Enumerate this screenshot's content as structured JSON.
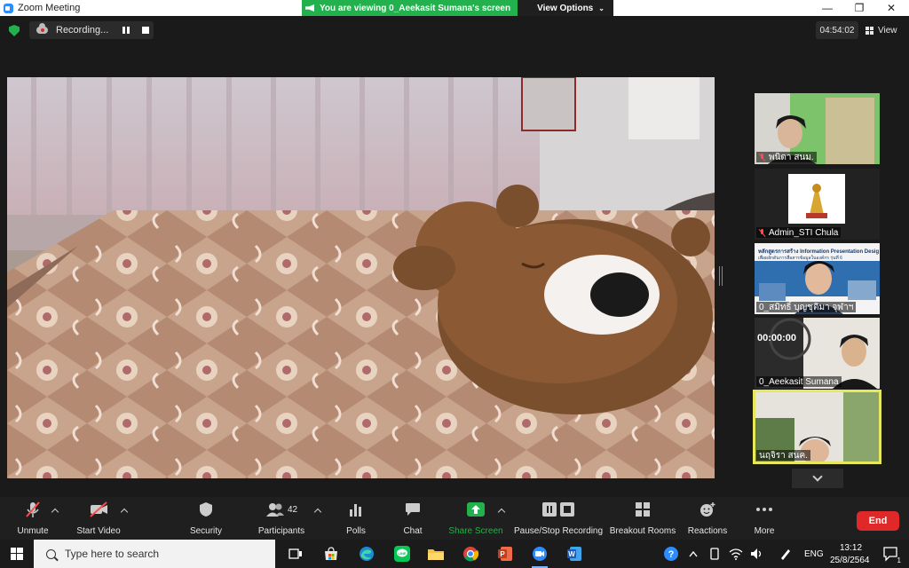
{
  "window": {
    "title": "Zoom Meeting",
    "minimize": "—",
    "maximize": "❐",
    "close": "✕"
  },
  "banner": {
    "viewing": "You are viewing 0_Aeekasit Sumana's screen",
    "view_options": "View Options"
  },
  "recording": {
    "label": "Recording..."
  },
  "meeting_timer": "04:54:02",
  "view_label": "View",
  "participants": [
    {
      "name": "พนิดา สนม.",
      "muted": true
    },
    {
      "name": "Admin_STI Chula",
      "muted": true
    },
    {
      "name": "0_สมิทธิ์ บุญชุติมา จุฬาฯ",
      "muted": false,
      "slide_line1": "หลักสูตรการสร้าง Information Presentation Design",
      "slide_line2": "เพื่อผลักดันการสื่อสารข้อมูลในองค์กร รุ่นที่ 6"
    },
    {
      "name": "0_Aeekasit Sumana",
      "muted": false,
      "timer_overlay": "00:00:00"
    },
    {
      "name": "นฤจิรา สนค.",
      "muted": false,
      "active_speaker": true
    }
  ],
  "toolbar": {
    "unmute": "Unmute",
    "start_video": "Start Video",
    "security": "Security",
    "participants": "Participants",
    "participants_count": "42",
    "polls": "Polls",
    "chat": "Chat",
    "share_screen": "Share Screen",
    "pause_stop_recording": "Pause/Stop Recording",
    "breakout_rooms": "Breakout Rooms",
    "reactions": "Reactions",
    "more": "More",
    "end": "End"
  },
  "colors": {
    "share_green": "#22b14c",
    "end_red": "#e02828",
    "active_speaker": "#e7e75a",
    "muted_red": "#ff4b4b"
  },
  "taskbar": {
    "search_placeholder": "Type here to search",
    "apps": [
      "task-view",
      "store",
      "edge",
      "line",
      "file-explorer",
      "chrome",
      "powerpoint",
      "zoom",
      "word"
    ],
    "active_apps": [
      "zoom"
    ],
    "language": "ENG",
    "time": "13:12",
    "date": "25/8/2564",
    "notifications": "1"
  }
}
